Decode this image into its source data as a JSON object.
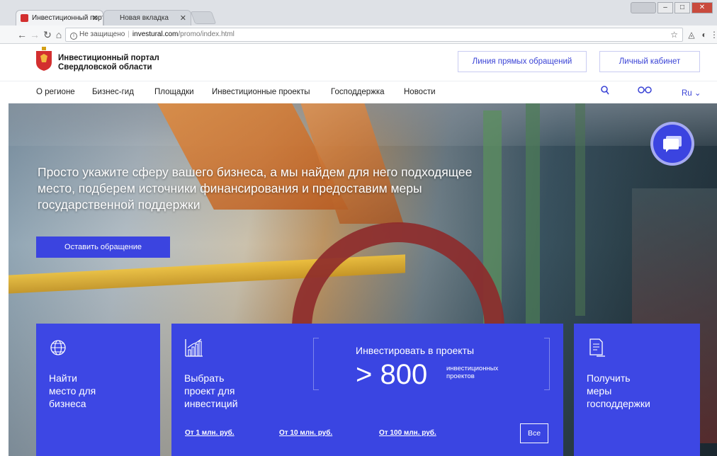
{
  "browser": {
    "tabs": [
      {
        "title": "Инвестиционный порта"
      },
      {
        "title": "Новая вкладка"
      }
    ],
    "url": {
      "security": "Не защищено",
      "host": "investural.com",
      "path": "/promo/index.html"
    }
  },
  "site": {
    "logo_line1": "Инвестиционный портал",
    "logo_line2": "Свердловской области",
    "header_buttons": {
      "hotline": "Линия прямых обращений",
      "account": "Личный кабинет"
    },
    "nav": [
      {
        "label": "О регионе"
      },
      {
        "label": "Бизнес-гид"
      },
      {
        "label": "Площадки"
      },
      {
        "label": "Инвестиционные проекты"
      },
      {
        "label": "Господдержка"
      },
      {
        "label": "Новости"
      }
    ],
    "nav_tools": {
      "search_icon": "search-icon",
      "accessibility_icon": "glasses-icon",
      "lang": "Ru"
    }
  },
  "hero": {
    "headline": "Просто укажите сферу вашего бизнеса, а мы найдем для него подходящее место, подберем источники финансирования и предоставим меры государственной поддержки",
    "cta": "Оставить обращение"
  },
  "cards": {
    "find_place": {
      "line1": "Найти",
      "line2": "место для",
      "line3": "бизнеса"
    },
    "choose_project": {
      "line1": "Выбрать",
      "line2": "проект для",
      "line3": "инвестиций"
    },
    "invest": {
      "title": "Инвестировать в проекты",
      "number": "> 800",
      "unit_line1": "инвестиционных",
      "unit_line2": "проектов"
    },
    "ranges": [
      "От 1 млн. руб.",
      "От 10 млн. руб.",
      "От 100 млн. руб."
    ],
    "all": "Все",
    "support": {
      "line1": "Получить",
      "line2": "меры",
      "line3": "господдержки"
    }
  },
  "colors": {
    "accent": "#3b44e0",
    "card": "#3d47e4"
  }
}
